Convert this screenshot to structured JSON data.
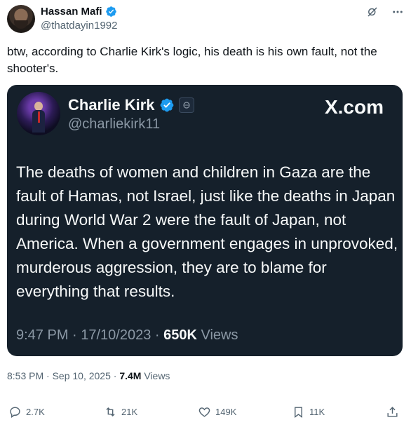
{
  "author": {
    "name": "Hassan Mafi",
    "handle": "@thatdayin1992"
  },
  "tweet_text": "btw, according to Charlie Kirk's logic, his death is his own fault, not the shooter's.",
  "quoted_card": {
    "name": "Charlie Kirk",
    "handle": "@charliekirk11",
    "site": "X.com",
    "text": "The deaths of women and children in Gaza are the fault of Hamas, not Israel, just like the deaths in Japan during World War 2 were the fault of Japan, not America. When a government engages in unprovoked, murderous aggression, they are to blame for everything that results.",
    "time": "9:47 PM · 17/10/2023 · ",
    "views_count": "650K",
    "views_label": " Views"
  },
  "meta": {
    "time": "8:53 PM · Sep 10, 2025 · ",
    "views_count": "7.4M",
    "views_label": " Views"
  },
  "actions": {
    "replies": "2.7K",
    "reposts": "21K",
    "likes": "149K",
    "bookmarks": "11K"
  },
  "colors": {
    "verified": "#1d9bf0",
    "card_bg": "#15202b",
    "muted": "#536471"
  },
  "icons": [
    "grok-icon",
    "more-icon",
    "reply-icon",
    "repost-icon",
    "like-icon",
    "bookmark-icon",
    "share-icon",
    "verified-icon"
  ]
}
